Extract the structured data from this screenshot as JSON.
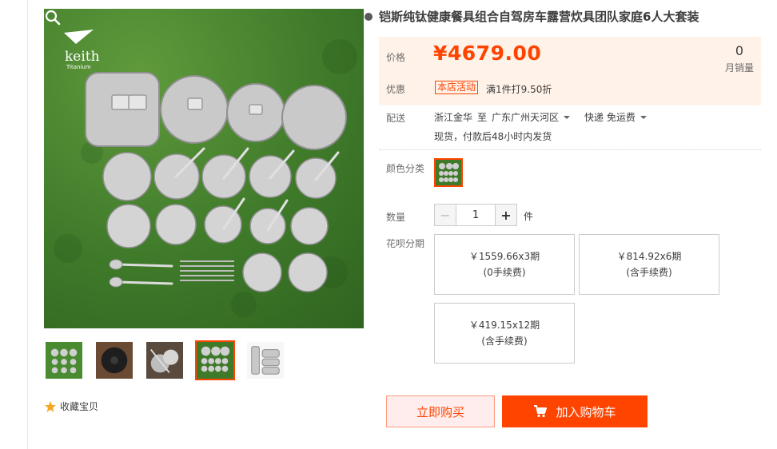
{
  "product": {
    "title": "铠斯纯钛健康餐具组合自驾房车露营炊具团队家庭6人大套装",
    "brand_logo_text": "keith",
    "brand_logo_sub": "Titanium"
  },
  "price": {
    "label": "价格",
    "value": "¥4679.00",
    "monthly_sales_count": "0",
    "monthly_sales_label": "月销量"
  },
  "promotion": {
    "label": "优惠",
    "tag": "本店活动",
    "text": "满1件打9.50折"
  },
  "shipping": {
    "label": "配送",
    "origin": "浙江金华",
    "to": "至",
    "destination": "广东广州天河区",
    "method": "快递 免运费",
    "note": "现货，付款后48小时内发货"
  },
  "color": {
    "label": "颜色分类"
  },
  "quantity": {
    "label": "数量",
    "value": "1",
    "unit": "件",
    "minus": "−",
    "plus": "+"
  },
  "installments": {
    "label": "花呗分期",
    "options": [
      {
        "amount": "￥1559.66x3期",
        "fee": "(0手续费)"
      },
      {
        "amount": "￥814.92x6期",
        "fee": "(含手续费)"
      },
      {
        "amount": "￥419.15x12期",
        "fee": "(含手续费)"
      }
    ]
  },
  "actions": {
    "buy_now": "立即购买",
    "add_to_cart": "加入购物车"
  },
  "favorite": {
    "label": "收藏宝贝"
  },
  "icons": {
    "zoom": "magnifier-icon",
    "cart": "cart-icon",
    "star": "star-icon"
  },
  "colors": {
    "accent": "#ff4400",
    "price_bg": "#fff2e8"
  }
}
